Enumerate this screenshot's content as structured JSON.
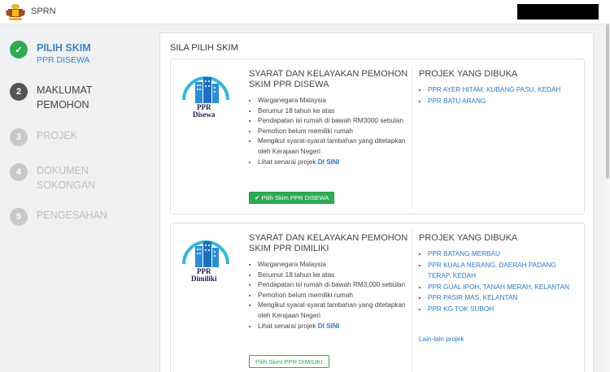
{
  "header": {
    "app_title": "SPRN"
  },
  "sidebar": {
    "steps": [
      {
        "number": "✓",
        "title": "PILIH SKIM",
        "subtitle": "PPR DISEWA",
        "state": "done"
      },
      {
        "number": "2",
        "title_line1": "MAKLUMAT",
        "title_line2": "PEMOHON",
        "state": "current"
      },
      {
        "number": "3",
        "title": "PROJEK",
        "state": "disabled"
      },
      {
        "number": "4",
        "title_line1": "DOKUMEN",
        "title_line2": "SOKONGAN",
        "state": "disabled"
      },
      {
        "number": "5",
        "title": "PENGESAHAN",
        "state": "disabled"
      }
    ]
  },
  "main": {
    "panel_title": "SILA PILIH SKIM",
    "cards": [
      {
        "logo_line1": "PPR",
        "logo_line2": "Disewa",
        "req_title": "SYARAT DAN KELAYAKAN PEMOHON SKIM PPR DISEWA",
        "requirements": [
          "Warganegara Malaysia",
          "Berumur 18 tahun ke atas",
          "Pendapatan isi rumah di bawah RM3000 sebulan",
          "Pemohon belum memiliki rumah",
          "Mengikut syarat-syarat tambahan yang ditetapkan oleh Kerajaan Negeri"
        ],
        "list_link_prefix": "Lihat senarai projek",
        "list_link_text": "DI SINI",
        "button_label": "✔ Pilih Skim PPR DISEWA",
        "projects_title": "PROJEK YANG DIBUKA",
        "projects": [
          "PPR AYER HITAM, KUBANG PASU, KEDAH",
          "PPR BATU ARANG"
        ]
      },
      {
        "logo_line1": "PPR",
        "logo_line2": "Dimiliki",
        "req_title": "SYARAT DAN KELAYAKAN PEMOHON SKIM PPR DIMILIKI",
        "requirements": [
          "Warganegara Malaysia",
          "Berumur 18 tahun ke atas",
          "Pendapatan isi rumah di bawah RM3,000 sebulan",
          "Pemohon belum memiliki rumah",
          "Mengikut syarat-syarat tambahan yang ditetapkan oleh Kerajaan Negeri"
        ],
        "list_link_prefix": "Lihat senarai projek",
        "list_link_text": "DI SINI",
        "button_label": "Pilih Skim PPR DIMILIKI",
        "projects_title": "PROJEK YANG DIBUKA",
        "projects": [
          "PPR BATANG MERBAU",
          "PPR KUALA NERANG, DAERAH PADANG TERAP, KEDAH",
          "PPR GUAL IPOH, TANAH MERAH, KELANTAN",
          "PPR PASIR MAS, KELANTAN",
          "PPR KG TOK SUBOH"
        ],
        "more_link": "Lain-lain projek"
      }
    ]
  }
}
